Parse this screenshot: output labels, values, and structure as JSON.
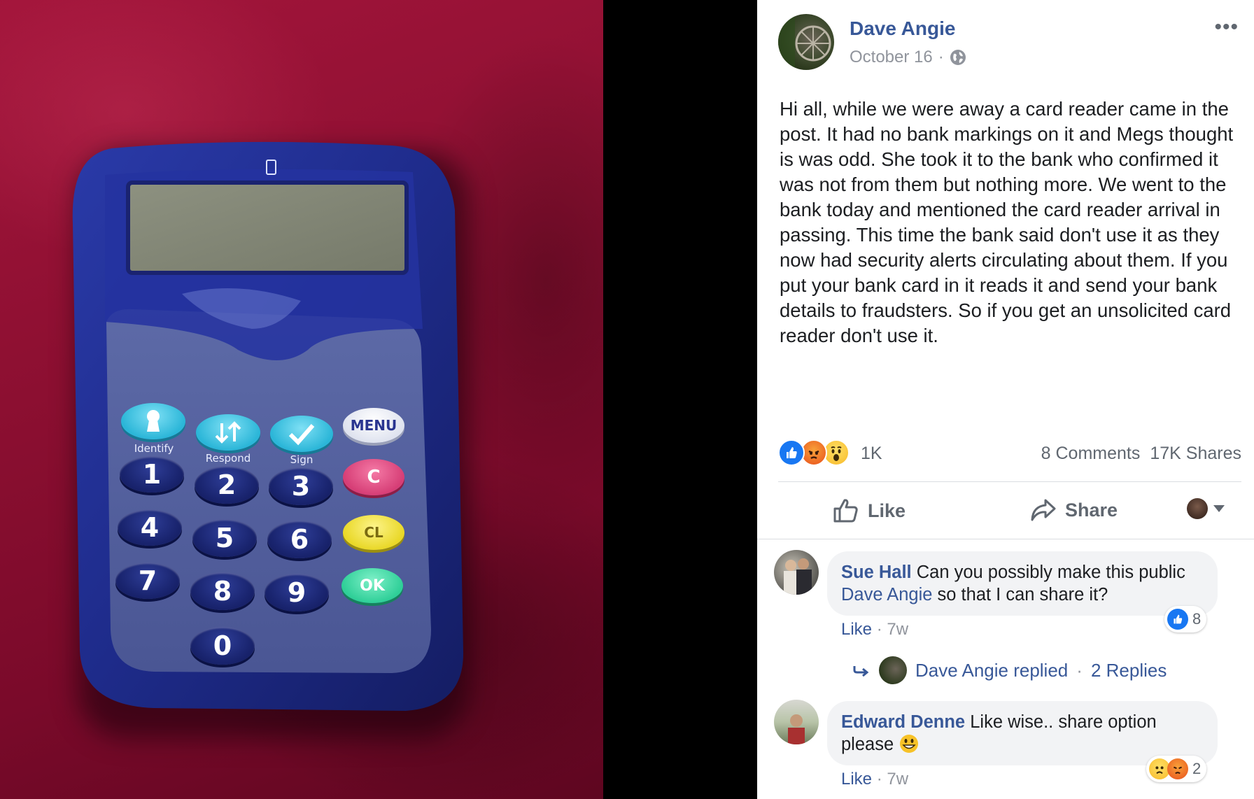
{
  "post": {
    "author": "Dave Angie",
    "date": "October 16",
    "date_separator": "·",
    "more_label": "•••",
    "text": "Hi all, while we were away a card reader came in the post. It had no bank markings on it and Megs thought is was odd. She took it to the bank who confirmed it was not from them but nothing more. We went to the bank today and mentioned the card reader arrival in passing. This time the bank said don't use it as they now had security alerts circulating about them. If you put your bank card in it reads it and send your bank details to fraudsters. So if you get an unsolicited card reader don't use it.",
    "reaction_count": "1K",
    "comments_count": "8 Comments",
    "shares_count": "17K Shares",
    "like_label": "Like",
    "share_label": "Share"
  },
  "comments": [
    {
      "author": "Sue Hall",
      "text_before": "Can you possibly make this public",
      "mention": "Dave Angie",
      "text_after": "so that I can share it?",
      "like_label": "Like",
      "time": "7w",
      "reaction_count": "8"
    },
    {
      "author": "Edward Denne",
      "text": "Like wise.. share option please",
      "like_label": "Like",
      "time": "7w",
      "reaction_count": "2"
    }
  ],
  "reply_summary": {
    "author_text": "Dave Angie replied",
    "separator": "·",
    "replies": "2 Replies"
  },
  "device": {
    "keys": {
      "k1": "1",
      "k2": "2",
      "k3": "3",
      "k4": "4",
      "k5": "5",
      "k6": "6",
      "k7": "7",
      "k8": "8",
      "k9": "9",
      "k0": "0",
      "menu": "MENU",
      "c": "C",
      "cl": "CL",
      "ok": "OK"
    },
    "labels": {
      "identify": "Identify",
      "respond": "Respond",
      "sign": "Sign"
    }
  },
  "colors": {
    "fb_link": "#385898",
    "fb_meta": "#90949c",
    "like_blue": "#1877f2",
    "angry_orange": "#f0662a",
    "device_blue": "#1f2b86",
    "fabric_red": "#8c0f31"
  }
}
